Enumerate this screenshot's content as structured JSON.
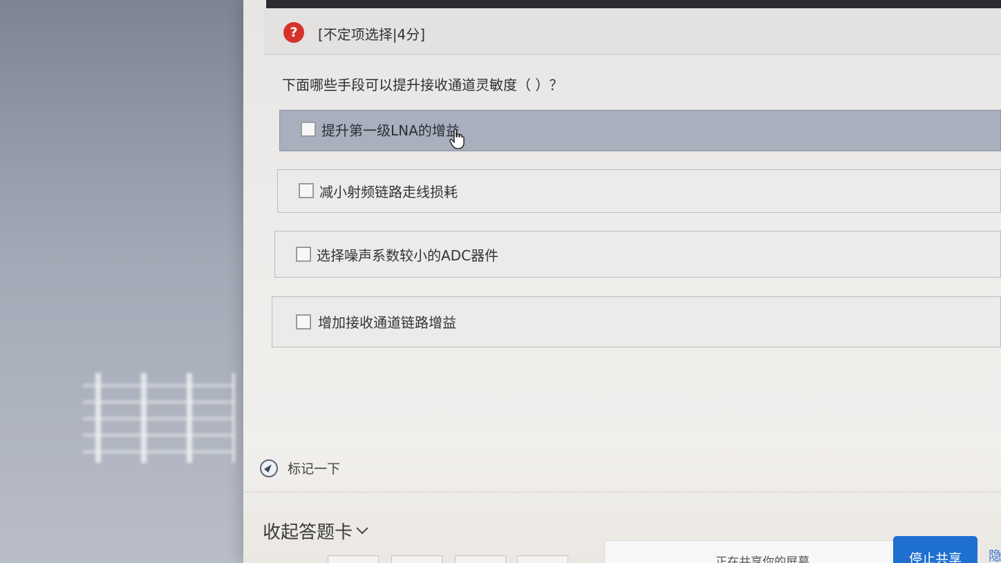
{
  "header": {
    "question_type": "[不定项选择|4分]"
  },
  "question": {
    "stem": "下面哪些手段可以提升接收通道灵敏度（ ）？",
    "options": [
      {
        "label": "提升第一级LNA的增益",
        "checked": false
      },
      {
        "label": "减小射频链路走线损耗",
        "checked": false
      },
      {
        "label": "选择噪声系数较小的ADC器件",
        "checked": false
      },
      {
        "label": "增加接收通道链路增益",
        "checked": false
      }
    ]
  },
  "mark": {
    "label": "标记一下",
    "icon": "compass-icon"
  },
  "answer_card": {
    "collapse_label": "收起答题卡",
    "chevron": "chevron-down-icon"
  },
  "screen_share": {
    "message": "正在共享你的屏幕",
    "stop_label": "停止共享",
    "hide_label": "隐"
  },
  "colors": {
    "help_icon": "#d6322b",
    "stop_button": "#1e6fd0",
    "hover_option": "#a9afbd"
  }
}
